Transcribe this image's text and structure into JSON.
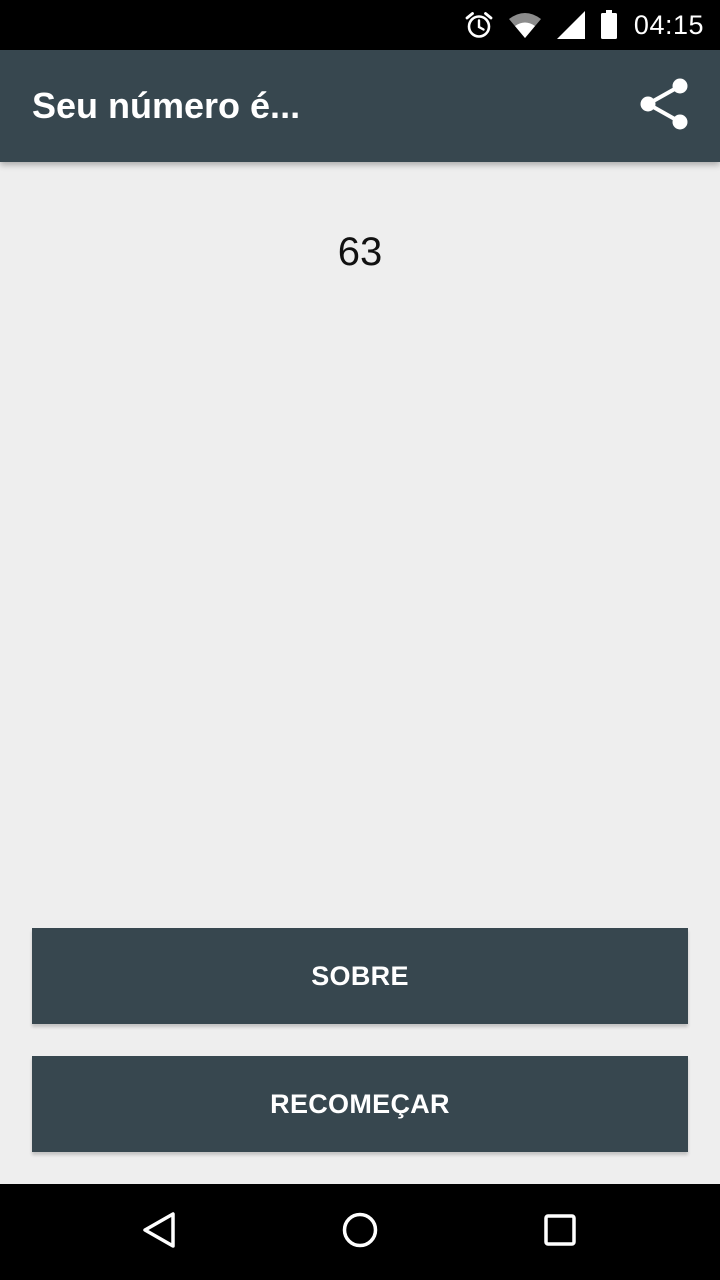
{
  "status_bar": {
    "time": "04:15",
    "icons": [
      "alarm-icon",
      "wifi-icon",
      "signal-icon",
      "battery-icon"
    ]
  },
  "app_bar": {
    "title": "Seu número é...",
    "action_icon": "share-icon"
  },
  "main": {
    "result_number": "63",
    "buttons": {
      "about_label": "SOBRE",
      "restart_label": "RECOMEÇAR"
    }
  },
  "nav_bar": {
    "icons": [
      "back-icon",
      "home-icon",
      "recents-icon"
    ]
  },
  "colors": {
    "primary": "#37474f",
    "background": "#eeeeee",
    "system_bars": "#000000"
  }
}
